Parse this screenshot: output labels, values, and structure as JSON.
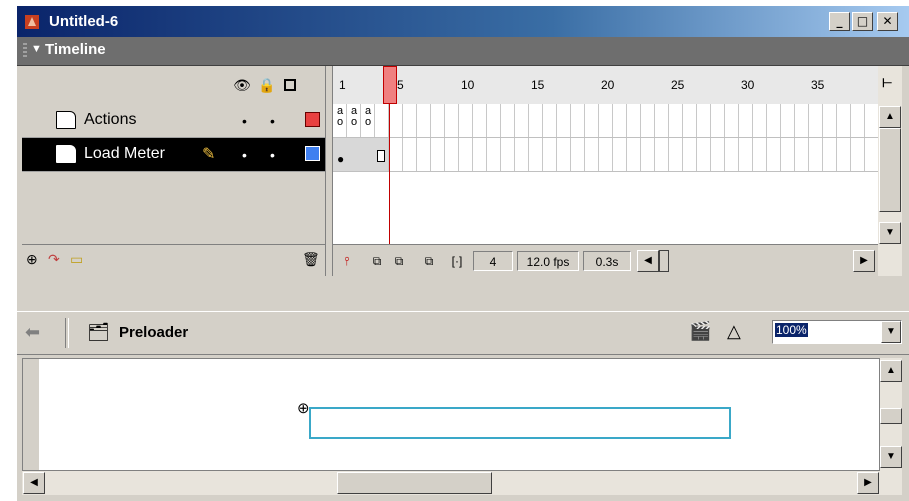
{
  "window": {
    "title": "Untitled-6",
    "min_label": "_",
    "max_label": "□",
    "close_label": "✕"
  },
  "panel": {
    "title": "Timeline"
  },
  "timeline": {
    "ruler_labels": [
      "1",
      "5",
      "10",
      "15",
      "20",
      "25",
      "30",
      "35"
    ],
    "layers": [
      {
        "name": "Actions",
        "dot1": "•",
        "dot2": "•",
        "color": "#e84040",
        "selected": false
      },
      {
        "name": "Load Meter",
        "dot1": "•",
        "dot2": "•",
        "color": "#4080f0",
        "selected": true
      }
    ],
    "current_frame": "4",
    "frame_rate": "12.0 fps",
    "elapsed_time": "0.3s",
    "keyframe_label": "a"
  },
  "edit_bar": {
    "symbol_name": "Preloader",
    "zoom": "100%"
  },
  "colors": {
    "playhead": "#f08080",
    "meter_stroke": "#3aa8c8"
  }
}
